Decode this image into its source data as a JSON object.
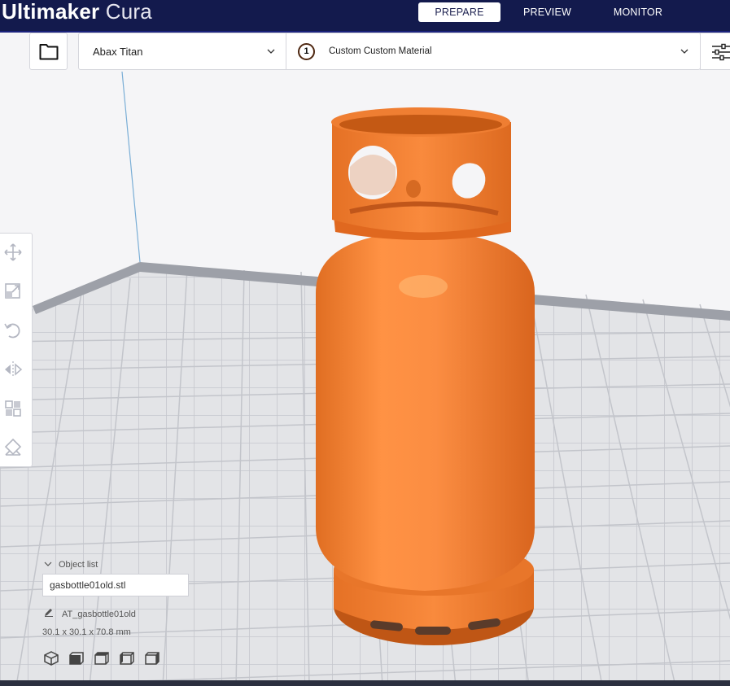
{
  "app": {
    "title_bold": "Ultimaker",
    "title_light": "Cura"
  },
  "stages": [
    {
      "label": "PREPARE",
      "active": true
    },
    {
      "label": "PREVIEW",
      "active": false
    },
    {
      "label": "MONITOR",
      "active": false
    }
  ],
  "printer": {
    "name": "Abax Titan"
  },
  "material": {
    "extruder_number": "1",
    "name": "Custom Custom Material"
  },
  "object_list": {
    "header": "Object list",
    "file": "gasbottle01old.stl",
    "object_name": "AT_gasbottle01old",
    "dimensions": "30.1 x 30.1 x 70.8 mm"
  },
  "tools": [
    "move-icon",
    "scale-icon",
    "rotate-icon",
    "mirror-icon",
    "per-model-settings-icon",
    "support-blocker-icon"
  ],
  "view_buttons": [
    "view-3d-icon",
    "view-front-icon",
    "view-top-icon",
    "view-left-icon",
    "view-right-icon"
  ],
  "colors": {
    "header": "#131a4d",
    "model": "#f0833a",
    "build_plate": "#e2e3e6"
  }
}
